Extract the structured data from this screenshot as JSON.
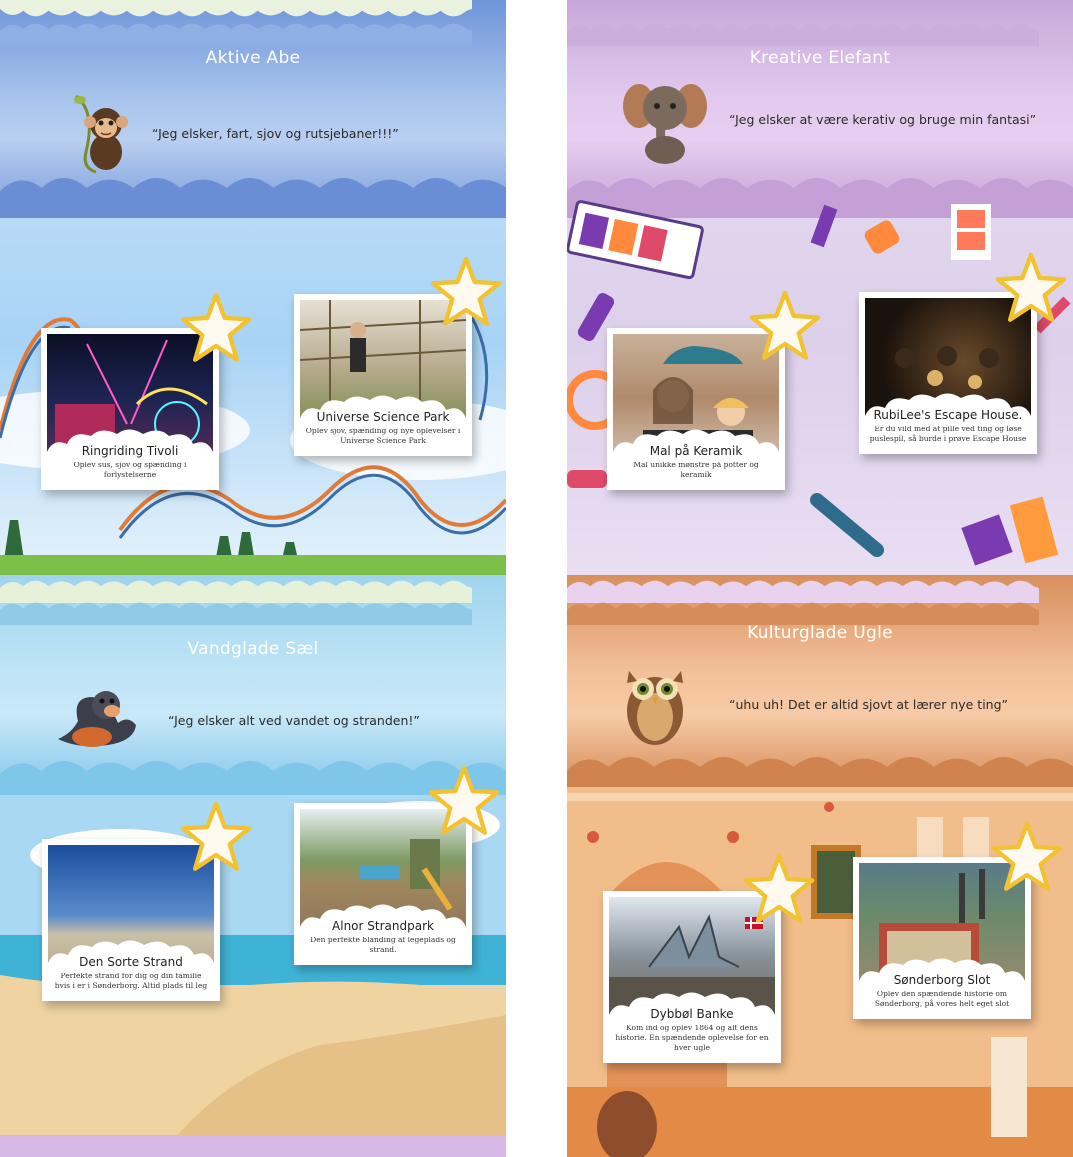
{
  "panels": {
    "aktive_abe": {
      "title": "Aktive Abe",
      "quote": "“Jeg elsker, fart, sjov og rutsjebaner!!!”",
      "mascot": "monkey-mascot",
      "accent": "#6b8fd8",
      "cards": [
        {
          "title": "Ringriding Tivoli",
          "desc": "Oplev sus, sjov og spænding i forlystelserne"
        },
        {
          "title": "Universe Science Park",
          "desc": "Oplev sjov, spænding og nye oplevelser i Universe Science Park"
        }
      ]
    },
    "kreative_elefant": {
      "title": "Kreative Elefant",
      "quote": "“Jeg elsker at være kerativ og bruge min fantasi”",
      "mascot": "elephant-mascot",
      "accent": "#c4a0d6",
      "cards": [
        {
          "title": "Mal på Keramik",
          "desc": "Mal unikke mønstre på potter og keramik"
        },
        {
          "title": "RubiLee's Escape House.",
          "desc": "Er du vild med at pille ved ting og løse puslespil, så burde i prøve Escape House"
        }
      ]
    },
    "vandglade_sael": {
      "title": "Vandglade Sæl",
      "quote": "“Jeg elsker alt ved vandet og stranden!”",
      "mascot": "seal-mascot",
      "accent": "#7ec6ea",
      "cards": [
        {
          "title": "Den Sorte Strand",
          "desc": "Perfekte strand for dig og din familie hvis i er i Sønderborg. Altid plads til leg"
        },
        {
          "title": "Alnor Strandpark",
          "desc": "Den perfekte blanding af legeplads og strand."
        }
      ]
    },
    "kulturglade_ugle": {
      "title": "Kulturglade Ugle",
      "quote": "“uhu uh! Det er altid sjovt at lærer nye ting”",
      "mascot": "owl-mascot",
      "accent": "#d98e5c",
      "cards": [
        {
          "title": "Dybbøl Banke",
          "desc": "Kom ind og oplev 1864 og alt dens historie. En spændende oplevelse for en hver ugle"
        },
        {
          "title": "Sønderborg Slot",
          "desc": "Oplev den spændende historie om Sønderborg, på vores helt eget slot"
        }
      ]
    }
  },
  "icons": {
    "star": "star-icon"
  }
}
